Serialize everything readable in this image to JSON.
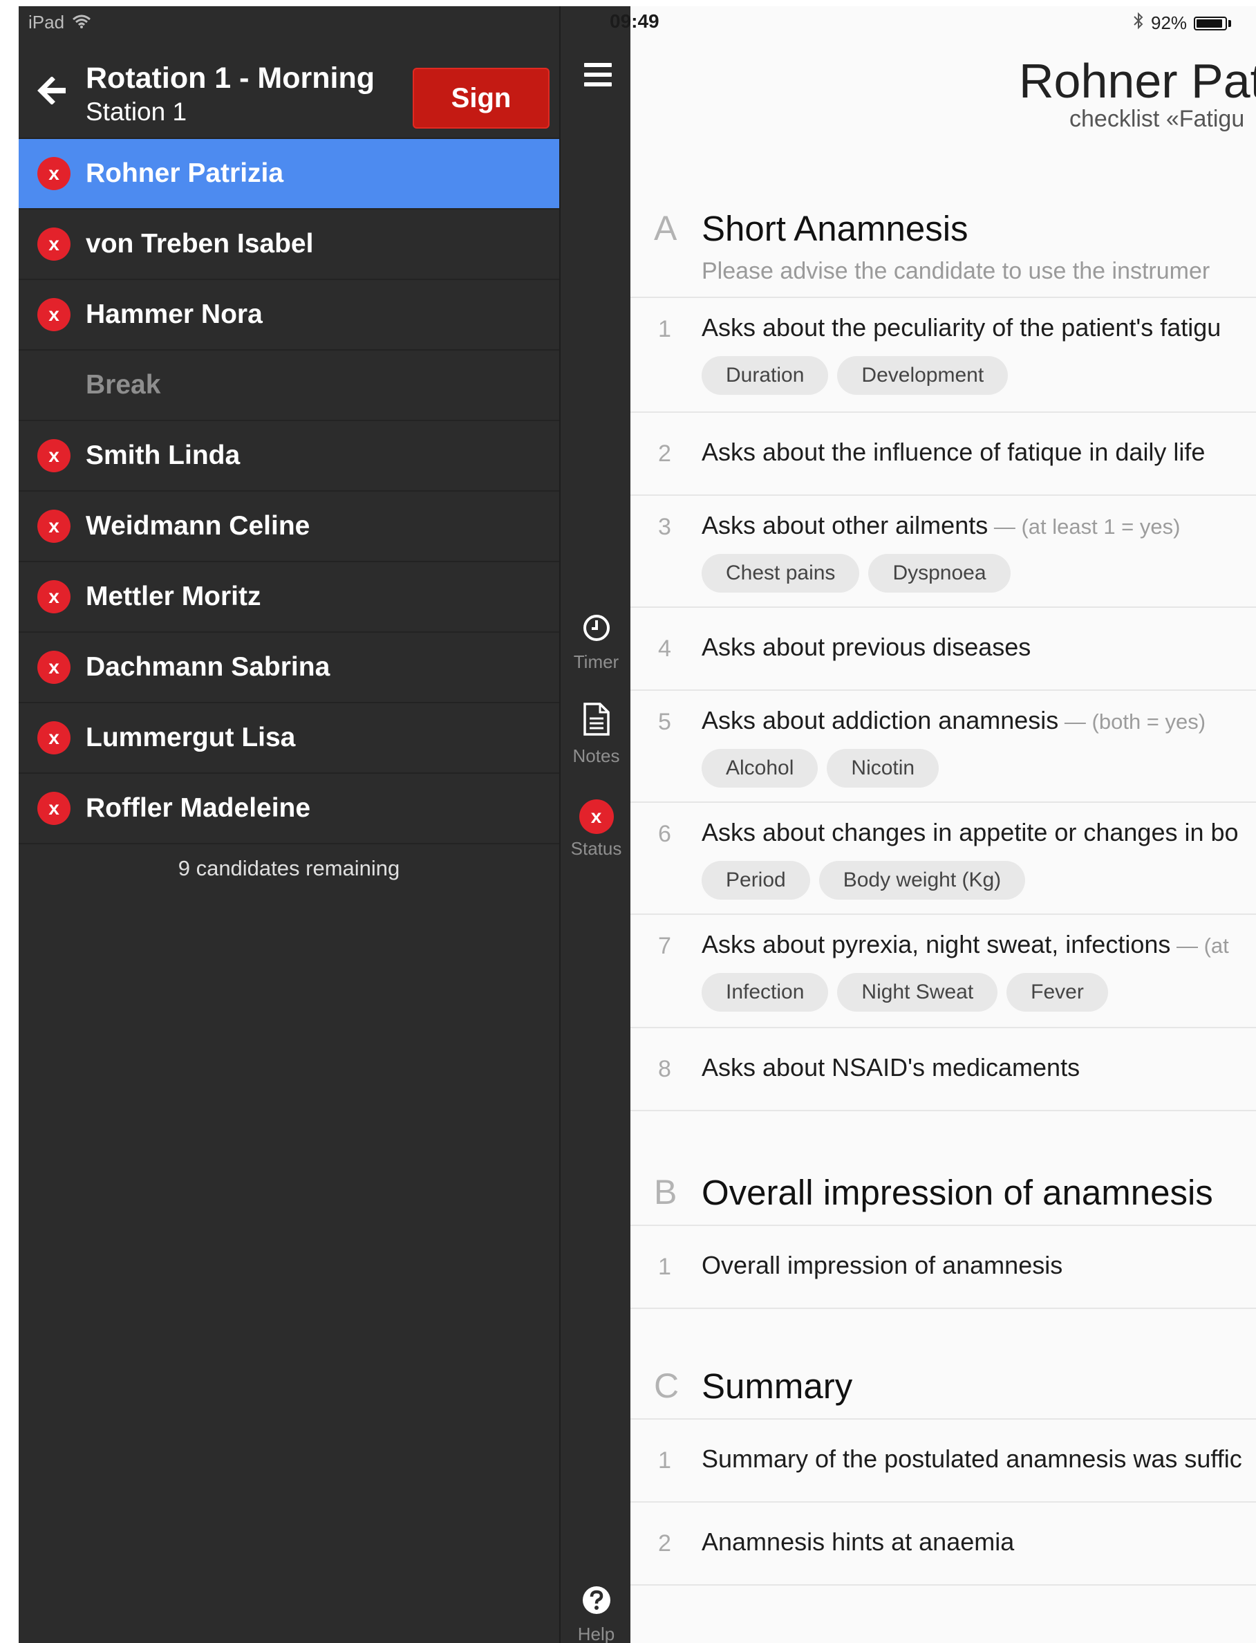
{
  "status_bar": {
    "device": "iPad",
    "time": "09:49",
    "battery_text": "92%",
    "battery_level": 0.92
  },
  "sidebar": {
    "title": "Rotation 1 - Morning",
    "subtitle": "Station 1",
    "sign_label": "Sign",
    "candidates": [
      {
        "name": "Rohner Patrizia",
        "status": "x",
        "selected": true
      },
      {
        "name": "von Treben Isabel",
        "status": "x"
      },
      {
        "name": "Hammer Nora",
        "status": "x"
      },
      {
        "name": "Break",
        "status": ""
      },
      {
        "name": "Smith Linda",
        "status": "x"
      },
      {
        "name": "Weidmann Celine",
        "status": "x"
      },
      {
        "name": "Mettler Moritz",
        "status": "x"
      },
      {
        "name": "Dachmann Sabrina",
        "status": "x"
      },
      {
        "name": "Lummergut Lisa",
        "status": "x"
      },
      {
        "name": "Roffler Madeleine",
        "status": "x"
      }
    ],
    "remaining": "9 candidates remaining"
  },
  "toolbar": {
    "timer_label": "Timer",
    "notes_label": "Notes",
    "status_label": "Status",
    "status_badge": "x",
    "help_label": "Help"
  },
  "main": {
    "patient_name": "Rohner Pat",
    "checklist_name": "checklist «Fatigu",
    "sections": [
      {
        "letter": "A",
        "title": "Short Anamnesis",
        "note": "Please advise the candidate to use the instrumer",
        "items": [
          {
            "num": "1",
            "text": "Asks about the peculiarity of the patient's fatigu",
            "hint": "",
            "chips": [
              "Duration",
              "Development"
            ]
          },
          {
            "num": "2",
            "text": "Asks about the influence of fatique in daily life",
            "hint": "",
            "chips": []
          },
          {
            "num": "3",
            "text": "Asks about other ailments",
            "hint": " — (at least 1 = yes)",
            "chips": [
              "Chest pains",
              "Dyspnoea"
            ]
          },
          {
            "num": "4",
            "text": "Asks about previous diseases",
            "hint": "",
            "chips": []
          },
          {
            "num": "5",
            "text": "Asks about addiction anamnesis",
            "hint": " — (both = yes)",
            "chips": [
              "Alcohol",
              "Nicotin"
            ]
          },
          {
            "num": "6",
            "text": "Asks about changes in appetite or changes in bo",
            "hint": "",
            "chips": [
              "Period",
              "Body weight (Kg)"
            ]
          },
          {
            "num": "7",
            "text": "Asks about pyrexia, night sweat, infections",
            "hint": " — (at",
            "chips": [
              "Infection",
              "Night Sweat",
              "Fever"
            ]
          },
          {
            "num": "8",
            "text": "Asks about NSAID's medicaments",
            "hint": "",
            "chips": []
          }
        ]
      },
      {
        "letter": "B",
        "title": "Overall impression of anamnesis",
        "note": "",
        "items": [
          {
            "num": "1",
            "text": "Overall impression of anamnesis",
            "hint": "",
            "chips": []
          }
        ]
      },
      {
        "letter": "C",
        "title": "Summary",
        "note": "",
        "items": [
          {
            "num": "1",
            "text": "Summary of the postulated anamnesis was suffic",
            "hint": "",
            "chips": []
          },
          {
            "num": "2",
            "text": "Anamnesis hints at anaemia",
            "hint": "",
            "chips": []
          }
        ]
      }
    ]
  },
  "colors": {
    "sidebar_bg": "#2c2c2c",
    "selected_row": "#4d8bf0",
    "sign_button": "#c41a13",
    "status_red": "#e3222b"
  }
}
